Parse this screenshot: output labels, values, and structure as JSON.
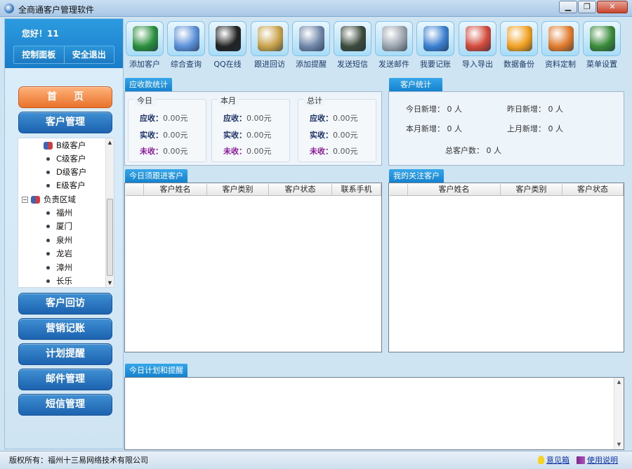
{
  "window": {
    "title": "全商通客户管理软件",
    "controls": [
      "▁",
      "❐",
      "✕"
    ]
  },
  "sidebar": {
    "greeting": "您好！11",
    "control_panel": "控制面板",
    "logout": "安全退出",
    "home": "首页",
    "customer_mgmt": "客户管理",
    "tree": [
      {
        "label": "B级客户",
        "type": "group"
      },
      {
        "label": "C级客户",
        "type": "leaf"
      },
      {
        "label": "D级客户",
        "type": "leaf"
      },
      {
        "label": "E级客户",
        "type": "leaf"
      },
      {
        "label": "负责区域",
        "type": "root"
      },
      {
        "label": "福州",
        "type": "leaf"
      },
      {
        "label": "厦门",
        "type": "leaf"
      },
      {
        "label": "泉州",
        "type": "leaf"
      },
      {
        "label": "龙岩",
        "type": "leaf"
      },
      {
        "label": "漳州",
        "type": "leaf"
      },
      {
        "label": "长乐",
        "type": "leaf"
      }
    ],
    "nav": [
      "客户回访",
      "营销记账",
      "计划提醒",
      "邮件管理",
      "短信管理"
    ]
  },
  "toolbar": [
    {
      "label": "添加客户",
      "icon": "add-customer-icon",
      "color": "#2a8f3c"
    },
    {
      "label": "综合查询",
      "icon": "search-magnifier-icon",
      "color": "#5a8fd8"
    },
    {
      "label": "QQ在线",
      "icon": "qq-penguin-icon",
      "color": "#222222"
    },
    {
      "label": "跟进回访",
      "icon": "telephone-icon",
      "color": "#c8a24a"
    },
    {
      "label": "添加提醒",
      "icon": "reminder-icon",
      "color": "#6f86a8"
    },
    {
      "label": "发送短信",
      "icon": "mobile-phone-icon",
      "color": "#3c4a3c"
    },
    {
      "label": "发送邮件",
      "icon": "newspaper-icon",
      "color": "#9aa3ad"
    },
    {
      "label": "我要记账",
      "icon": "ledger-blocks-icon",
      "color": "#3a7fd0"
    },
    {
      "label": "导入导出",
      "icon": "import-export-icon",
      "color": "#d24a3a"
    },
    {
      "label": "数据备份",
      "icon": "backup-lightning-icon",
      "color": "#f0a020"
    },
    {
      "label": "资料定制",
      "icon": "tools-icon",
      "color": "#e07a2a"
    },
    {
      "label": "菜单设置",
      "icon": "menu-settings-icon",
      "color": "#3a8a3a"
    }
  ],
  "receivables": {
    "tab": "应收款统计",
    "groups": [
      {
        "title": "今日",
        "receivable": "0.00元",
        "received": "0.00元",
        "unpaid": "0.00元"
      },
      {
        "title": "本月",
        "receivable": "0.00元",
        "received": "0.00元",
        "unpaid": "0.00元"
      },
      {
        "title": "总计",
        "receivable": "0.00元",
        "received": "0.00元",
        "unpaid": "0.00元"
      }
    ],
    "labels": {
      "receivable": "应收：",
      "received": "实收：",
      "unpaid": "未收："
    }
  },
  "customer_stats": {
    "tab": "客户统计",
    "today_new_label": "今日新增：",
    "today_new": "0 人",
    "yesterday_new_label": "昨日新增：",
    "yesterday_new": "0 人",
    "month_new_label": "本月新增：",
    "month_new": "0 人",
    "last_month_new_label": "上月新增：",
    "last_month_new": "0 人",
    "total_label": "总客户数：",
    "total": "0 人"
  },
  "followup": {
    "tab": "今日须跟进客户",
    "columns": [
      "",
      "客户姓名",
      "客户类别",
      "客户状态",
      "联系手机"
    ]
  },
  "watched": {
    "tab": "我的关注客户",
    "columns": [
      "",
      "客户姓名",
      "客户类别",
      "客户状态"
    ]
  },
  "plans": {
    "tab": "今日计划和提醒"
  },
  "status": {
    "copyright": "版权所有：福州十三易网络技术有限公司",
    "feedback": "意见箱",
    "manual": "使用说明"
  }
}
